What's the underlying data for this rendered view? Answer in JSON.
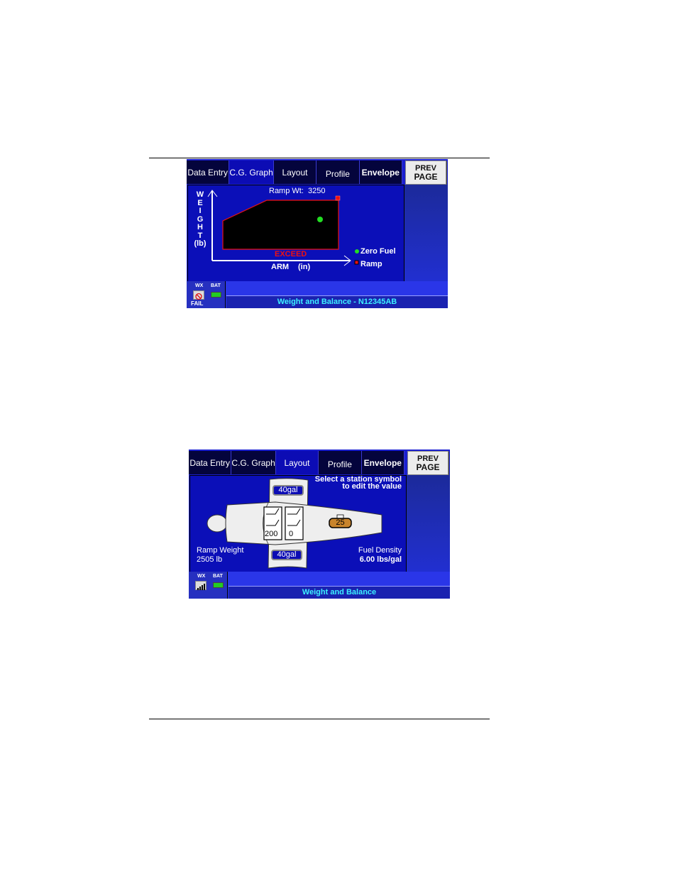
{
  "tabs": [
    {
      "label": "Data Entry"
    },
    {
      "label": "C.G. Graph"
    },
    {
      "label": "Layout"
    },
    {
      "label": "Profile"
    },
    {
      "label": "Envelope"
    }
  ],
  "prev_page": {
    "line1": "PREV",
    "line2": "PAGE"
  },
  "screen1": {
    "active_tab": "C.G. Graph",
    "y_axis_letters": [
      "W",
      "E",
      "I",
      "G",
      "H",
      "T",
      "(lb)"
    ],
    "x_axis_label": "ARM",
    "x_axis_unit": "(in)",
    "ramp_wt_label": "Ramp Wt:",
    "ramp_wt_value": "3250",
    "exceed_label": "EXCEED",
    "legend": [
      {
        "label": "Zero Fuel",
        "color": "#22dd22",
        "marker": "circle"
      },
      {
        "label": "Ramp",
        "color": "#ee1111",
        "marker": "square"
      }
    ],
    "status": {
      "wx_label": "WX",
      "bat_label": "BAT",
      "wx_state": "FAIL",
      "title": "Weight and Balance - N12345AB"
    }
  },
  "screen2": {
    "active_tab": "Layout",
    "instruction_line1": "Select a station symbol",
    "instruction_line2": "to edit the value",
    "wing_tank_top": "40gal",
    "wing_tank_bottom": "40gal",
    "seat_row1_value": "200",
    "seat_row2_value": "0",
    "baggage_value": "25",
    "ramp_weight_label": "Ramp Weight",
    "ramp_weight_value": "2505 lb",
    "fuel_density_label": "Fuel Density",
    "fuel_density_value": "6.00 lbs/gal",
    "status": {
      "wx_label": "WX",
      "bat_label": "BAT",
      "title": "Weight and Balance"
    }
  },
  "colors": {
    "screen_bg": "#0b0fb8",
    "envelope_border": "#ee1111",
    "exceed": "#ee1111",
    "status_title": "#3cf0ff",
    "baggage": "#c8842c"
  }
}
